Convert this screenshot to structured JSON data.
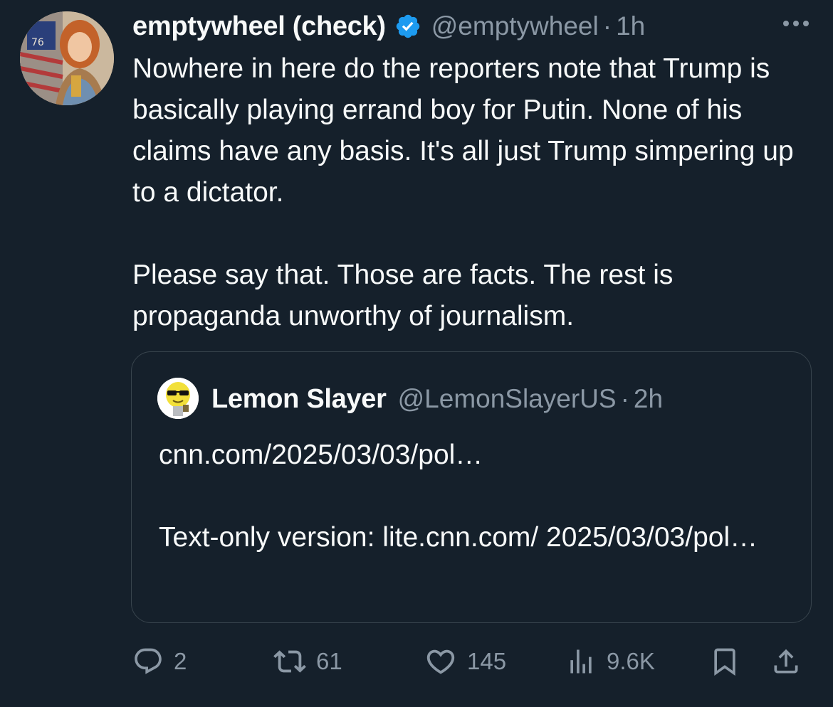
{
  "tweet": {
    "author": {
      "display_name": "emptywheel (check)",
      "handle": "@emptywheel",
      "avatar_label": "76"
    },
    "time": "1h",
    "separator": "·",
    "paragraphs": [
      "Nowhere in here do the reporters note that Trump is basically playing errand boy for Putin. None of his claims have any basis. It's all just Trump simpering up to a dictator.",
      "Please say that. Those are facts. The rest is propaganda unworthy of journalism."
    ]
  },
  "quote": {
    "author": {
      "display_name": "Lemon Slayer",
      "handle": "@LemonSlayerUS"
    },
    "time": "2h",
    "separator": "·",
    "paragraphs": [
      "cnn.com/2025/03/03/pol…",
      "Text-only version: lite.cnn.com/ 2025/03/03/pol…"
    ]
  },
  "actions": {
    "replies": "2",
    "reposts": "61",
    "likes": "145",
    "views": "9.6K"
  },
  "icons": {
    "verified": "verified-badge-icon",
    "more": "more-icon",
    "reply": "reply-icon",
    "repost": "repost-icon",
    "like": "heart-icon",
    "views": "views-chart-icon",
    "bookmark": "bookmark-icon",
    "share": "share-icon"
  },
  "colors": {
    "background": "#15202b",
    "text": "#f7f9f9",
    "muted": "#8b98a5",
    "verified": "#1d9bf0",
    "border": "#38444d"
  }
}
